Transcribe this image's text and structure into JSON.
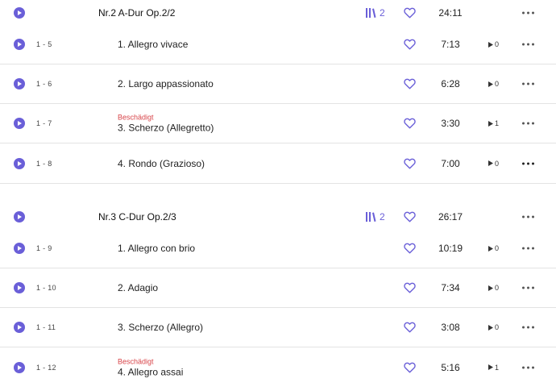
{
  "colors": {
    "accent": "#6a5fd8",
    "damaged": "#d8454a",
    "divider": "#e3e3e3"
  },
  "works": [
    {
      "title": "Nr.2 A-Dur Op.2/2",
      "versions": "2",
      "duration": "24:11",
      "tracks": [
        {
          "num": "1 - 5",
          "title": "1. Allegro vivace",
          "damaged": "",
          "duration": "7:13",
          "plays": "0"
        },
        {
          "num": "1 - 6",
          "title": "2. Largo appassionato",
          "damaged": "",
          "duration": "6:28",
          "plays": "0"
        },
        {
          "num": "1 - 7",
          "title": "3. Scherzo (Allegretto)",
          "damaged": "Beschädigt",
          "duration": "3:30",
          "plays": "1"
        },
        {
          "num": "1 - 8",
          "title": "4. Rondo (Grazioso)",
          "damaged": "",
          "duration": "7:00",
          "plays": "0"
        }
      ]
    },
    {
      "title": "Nr.3 C-Dur Op.2/3",
      "versions": "2",
      "duration": "26:17",
      "tracks": [
        {
          "num": "1 - 9",
          "title": "1. Allegro con brio",
          "damaged": "",
          "duration": "10:19",
          "plays": "0"
        },
        {
          "num": "1 - 10",
          "title": "2. Adagio",
          "damaged": "",
          "duration": "7:34",
          "plays": "0"
        },
        {
          "num": "1 - 11",
          "title": "3. Scherzo (Allegro)",
          "damaged": "",
          "duration": "3:08",
          "plays": "0"
        },
        {
          "num": "1 - 12",
          "title": "4. Allegro assai",
          "damaged": "Beschädigt",
          "duration": "5:16",
          "plays": "1"
        }
      ]
    }
  ]
}
